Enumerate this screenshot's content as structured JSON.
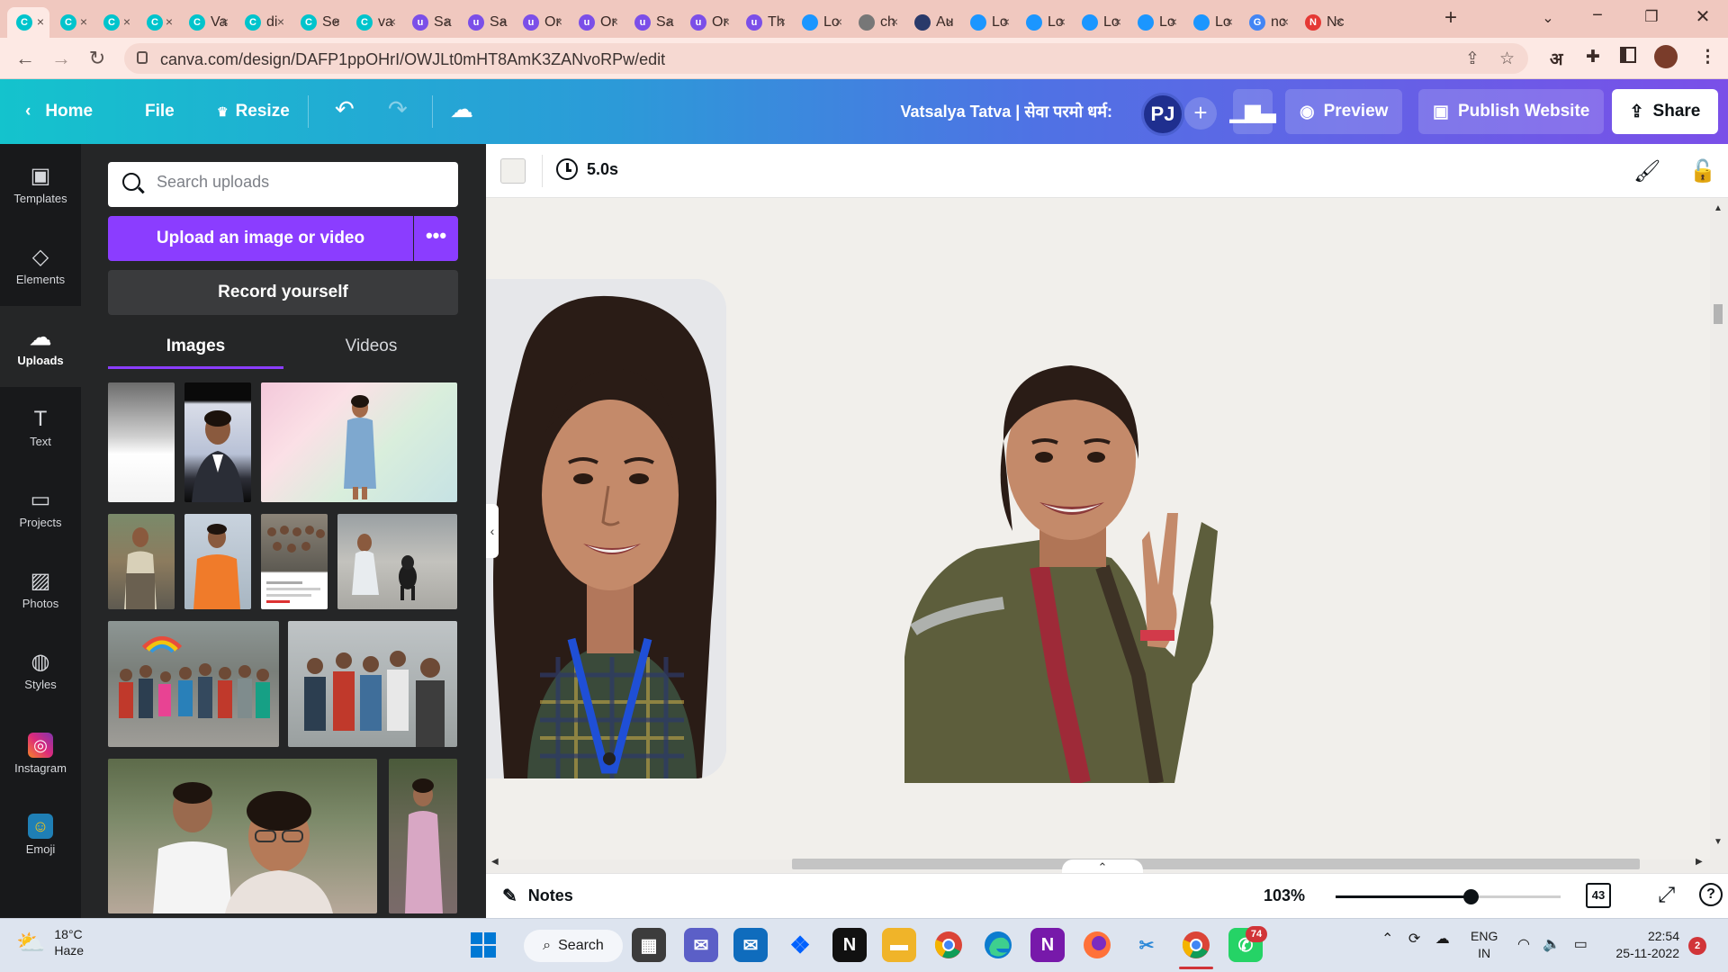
{
  "browser": {
    "tabs": [
      {
        "title": "",
        "icon": "canva-icon",
        "color": "#00c4cc",
        "active": true
      },
      {
        "title": "",
        "icon": "canva-icon",
        "color": "#00c4cc"
      },
      {
        "title": "",
        "icon": "canva-icon",
        "color": "#00c4cc"
      },
      {
        "title": "",
        "icon": "canva-icon",
        "color": "#00c4cc"
      },
      {
        "title": "Va",
        "icon": "canva-icon",
        "color": "#00c4cc"
      },
      {
        "title": "di",
        "icon": "canva-icon",
        "color": "#00c4cc"
      },
      {
        "title": "Se",
        "icon": "canva-icon",
        "color": "#00c4cc"
      },
      {
        "title": "va",
        "icon": "canva-icon",
        "color": "#00c4cc"
      },
      {
        "title": "Sa",
        "icon": "purple-u-icon",
        "color": "#7b4fe8"
      },
      {
        "title": "Sa",
        "icon": "purple-u-icon",
        "color": "#7b4fe8"
      },
      {
        "title": "Or",
        "icon": "purple-u-icon",
        "color": "#7b4fe8"
      },
      {
        "title": "Or",
        "icon": "purple-u-icon",
        "color": "#7b4fe8"
      },
      {
        "title": "Sa",
        "icon": "purple-u-icon",
        "color": "#7b4fe8"
      },
      {
        "title": "Or",
        "icon": "purple-u-icon",
        "color": "#7b4fe8"
      },
      {
        "title": "Th",
        "icon": "purple-u-icon",
        "color": "#7b4fe8"
      },
      {
        "title": "Lo",
        "icon": "cloud-icon",
        "color": "#1b96ff"
      },
      {
        "title": "ch",
        "icon": "globe-icon",
        "color": "#777777"
      },
      {
        "title": "Au",
        "icon": "mountain-icon",
        "color": "#2a3a6a"
      },
      {
        "title": "Lo",
        "icon": "cloud-icon",
        "color": "#1b96ff"
      },
      {
        "title": "Lo",
        "icon": "cloud-icon",
        "color": "#1b96ff"
      },
      {
        "title": "Lo",
        "icon": "cloud-icon",
        "color": "#1b96ff"
      },
      {
        "title": "Lo",
        "icon": "cloud-icon",
        "color": "#1b96ff"
      },
      {
        "title": "Lo",
        "icon": "cloud-icon",
        "color": "#1b96ff"
      },
      {
        "title": "nc",
        "icon": "google-icon",
        "color": "#4285f4"
      },
      {
        "title": "Nc",
        "icon": "ns-icon",
        "color": "#e53935"
      }
    ],
    "url": "canva.com/design/DAFP1ppOHrI/OWJLt0mHT8AmK3ZANvoRPw/edit",
    "devanagari_ext": "अ"
  },
  "header": {
    "home": "Home",
    "file": "File",
    "resize": "Resize",
    "title": "Vatsalya Tatva | सेवा परमो धर्म:",
    "avatar": "PJ",
    "preview": "Preview",
    "publish": "Publish Website",
    "share": "Share"
  },
  "rail": [
    {
      "label": "Templates",
      "icon": "templates-icon"
    },
    {
      "label": "Elements",
      "icon": "elements-icon"
    },
    {
      "label": "Uploads",
      "icon": "upload-cloud-icon",
      "active": true
    },
    {
      "label": "Text",
      "icon": "text-icon"
    },
    {
      "label": "Projects",
      "icon": "folder-icon"
    },
    {
      "label": "Photos",
      "icon": "photos-icon"
    },
    {
      "label": "Styles",
      "icon": "palette-icon"
    },
    {
      "label": "Instagram",
      "icon": "instagram-icon"
    },
    {
      "label": "Emoji",
      "icon": "emoji-icon"
    }
  ],
  "panel": {
    "search_placeholder": "Search uploads",
    "upload_label": "Upload an image or video",
    "more_label": "•••",
    "record_label": "Record yourself",
    "tabs": [
      {
        "label": "Images",
        "active": true
      },
      {
        "label": "Videos"
      }
    ]
  },
  "canvas": {
    "duration": "5.0s",
    "notes": "Notes",
    "zoom": "103%",
    "zoom_level": 0.6,
    "page_count": "43"
  },
  "taskbar": {
    "temp": "18°C",
    "condition": "Haze",
    "search": "Search",
    "lang_top": "ENG",
    "lang_bottom": "IN",
    "time": "22:54",
    "date": "25-11-2022",
    "whatsapp_badge": "74",
    "notif_badge": "2"
  }
}
